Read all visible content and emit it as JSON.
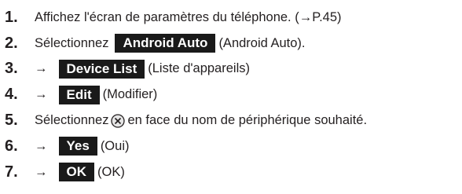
{
  "steps": [
    {
      "number": "1.",
      "text": "Affichez l'écran de paramètres du téléphone. (→P.45)"
    },
    {
      "number": "2.",
      "before": "Sélectionnez",
      "button": "Android Auto",
      "after": "(Android Auto)."
    },
    {
      "number": "3.",
      "arrow": "→",
      "button": "Device List",
      "after": "(Liste d'appareils)"
    },
    {
      "number": "4.",
      "arrow": "→",
      "button": "Edit",
      "after": "(Modifier)"
    },
    {
      "number": "5.",
      "before": "Sélectionnez",
      "icon": "delete-x-icon",
      "after": "en face du nom de périphérique souhaité."
    },
    {
      "number": "6.",
      "arrow": "→",
      "button": "Yes",
      "after": "(Oui)"
    },
    {
      "number": "7.",
      "arrow": "→",
      "button": "OK",
      "after": "(OK)"
    }
  ],
  "colors": {
    "text": "#231f20",
    "button_bg": "#1a1a1a",
    "button_text": "#ffffff"
  }
}
